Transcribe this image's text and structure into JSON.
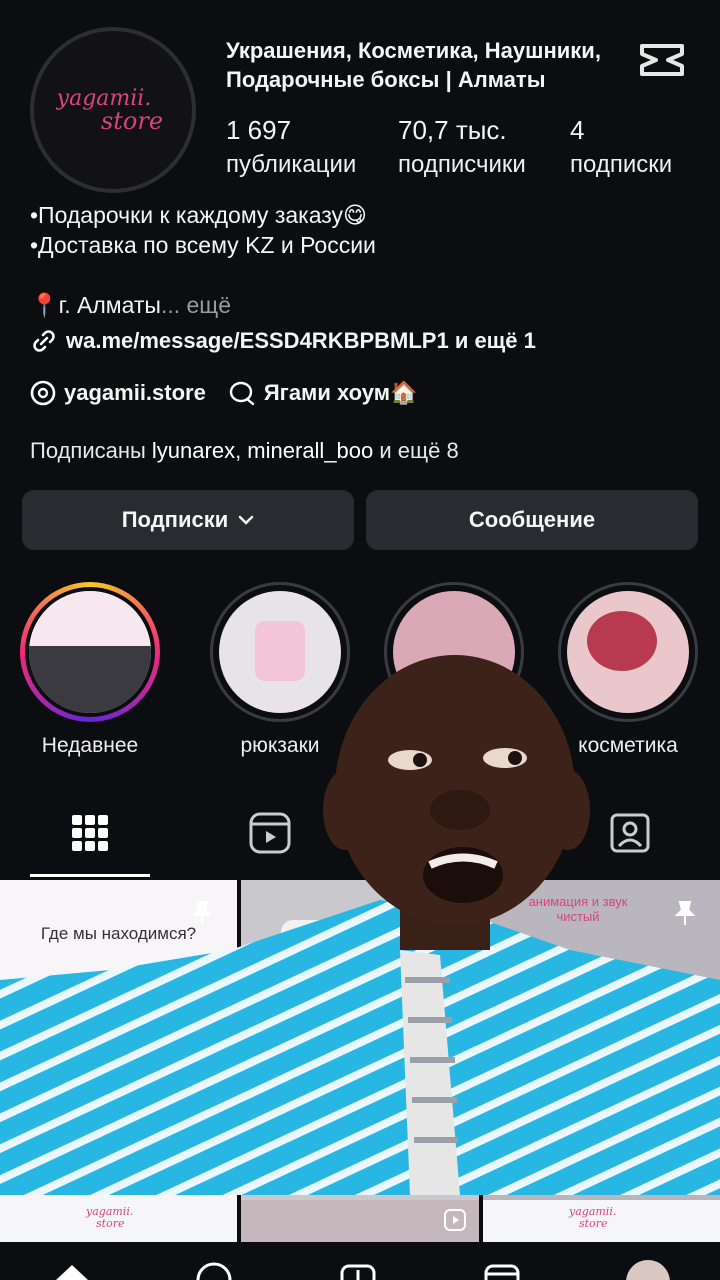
{
  "profile": {
    "title_line1": "Украшения, Косметика, Наушники,",
    "title_line2": "Подарочные боксы | Алматы",
    "avatar_line1": "yagamii.",
    "avatar_line2": "store",
    "stats": [
      {
        "num": "1 697",
        "label": "публикации"
      },
      {
        "num": "70,7 тыс.",
        "label": "подписчики"
      },
      {
        "num": "4",
        "label": "подписки"
      }
    ],
    "bio_line1": "•Подарочки к каждому заказу😋",
    "bio_line2": "•Доставка по всему KZ и России",
    "location": "📍г. Алматы",
    "location_more": "... ещё",
    "link": "wa.me/message/ESSD4RKBPBMLP1 и ещё 1",
    "threads_label": "yagamii.store",
    "home_label": "Ягами хоум🏠",
    "followed_prefix": "Подписаны ",
    "followed_names": "lyunarex, minerall_boo",
    "followed_suffix": " и ещё 8"
  },
  "buttons": {
    "subscriptions": "Подписки",
    "message": "Сообщение"
  },
  "highlights": [
    {
      "name": "Недавнее"
    },
    {
      "name": "рюкзаки"
    },
    {
      "name": ""
    },
    {
      "name": "косметика"
    }
  ],
  "grid": {
    "post1_caption": "Где мы находимся?",
    "post3_caption_line1": "анимация и звук",
    "post3_caption_line2": "чистый",
    "mini_logo_line1": "yagamii.",
    "mini_logo_line2": "store"
  },
  "colors": {
    "background": "#0c0d10",
    "button": "#2a2b30",
    "brand_pink": "#d8457a",
    "story_ring_gradient": [
      "#f9c926",
      "#ee2a7b",
      "#6228d7"
    ]
  }
}
